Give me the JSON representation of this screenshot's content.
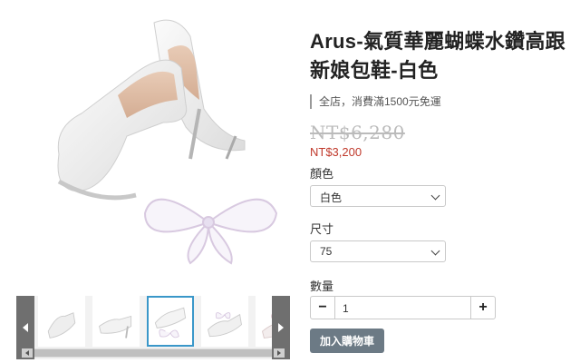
{
  "product": {
    "title": "Arus-氣質華麗蝴蝶水鑽高跟新娘包鞋-白色",
    "promo": "全店，消費滿1500元免運",
    "original_price": "NT$6,280",
    "sale_price": "NT$3,200"
  },
  "options": {
    "color": {
      "label": "顏色",
      "value": "白色"
    },
    "size": {
      "label": "尺寸",
      "value": "75"
    },
    "quantity": {
      "label": "數量",
      "value": "1",
      "minus": "−",
      "plus": "+"
    }
  },
  "cart": {
    "button_label": "加入購物車"
  },
  "gallery": {
    "thumb_count": 5,
    "active_thumb": 2
  },
  "colors": {
    "accent": "#3a97c9",
    "sale_price": "#c0392b",
    "original_price": "#bbbbbb",
    "cart_button": "#6c7a85"
  }
}
